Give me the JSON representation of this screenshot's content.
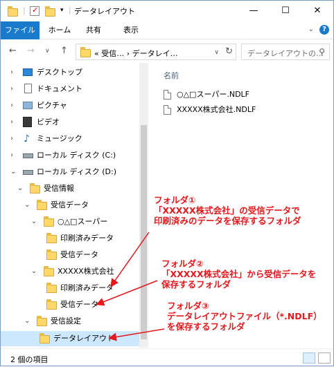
{
  "window": {
    "title": "データレイアウト",
    "controls": {
      "minimize": "—",
      "maximize": "☐",
      "close": "✕"
    }
  },
  "ribbon": {
    "tabs": [
      "ファイル",
      "ホーム",
      "共有",
      "表示"
    ],
    "help": "?"
  },
  "address": {
    "path": "«  受信…  ›  データレイ…",
    "search_placeholder": "データレイアウトの…"
  },
  "nav_tree": [
    {
      "label": "デスクトップ",
      "icon": "desktop-icon"
    },
    {
      "label": "ドキュメント",
      "icon": "documents-icon"
    },
    {
      "label": "ピクチャ",
      "icon": "pictures-icon"
    },
    {
      "label": "ビデオ",
      "icon": "videos-icon"
    },
    {
      "label": "ミュージック",
      "icon": "music-icon"
    },
    {
      "label": "ローカル ディスク (C:)",
      "icon": "drive-icon"
    },
    {
      "label": "ローカル ディスク (D:)",
      "icon": "drive-icon"
    },
    {
      "label": "受信情報",
      "icon": "folder-icon"
    },
    {
      "label": "受信データ",
      "icon": "folder-icon"
    },
    {
      "label": "○△□スーパー",
      "icon": "folder-icon"
    },
    {
      "label": "印刷済みデータ",
      "icon": "folder-icon"
    },
    {
      "label": "受信データ",
      "icon": "folder-icon"
    },
    {
      "label": "XXXXX株式会社",
      "icon": "folder-icon"
    },
    {
      "label": "印刷済みデータ",
      "icon": "folder-icon"
    },
    {
      "label": "受信データ",
      "icon": "folder-icon"
    },
    {
      "label": "受信設定",
      "icon": "folder-icon"
    },
    {
      "label": "データレイアウト",
      "icon": "folder-icon"
    }
  ],
  "main": {
    "column_header": "名前",
    "files": [
      "○△□スーパー.NDLF",
      "XXXXX株式会社.NDLF"
    ]
  },
  "status": {
    "item_count": "2 個の項目"
  },
  "annotations": [
    {
      "lines": [
        "フォルダ①",
        "「XXXXX株式会社」の受信データで",
        "印刷済みのデータを保存するフォルダ"
      ]
    },
    {
      "lines": [
        "フォルダ②",
        "「XXXXX株式会社」から受信データを",
        "保存するフォルダ"
      ]
    },
    {
      "lines": [
        "フォルダ③",
        "データレイアウトファイル（*.NDLF）",
        "を保存するフォルダ"
      ]
    }
  ],
  "colors": {
    "accent": "#1979ca",
    "annotation": "#e5171b",
    "selection": "#cce8ff",
    "folder": "#ffd867"
  }
}
